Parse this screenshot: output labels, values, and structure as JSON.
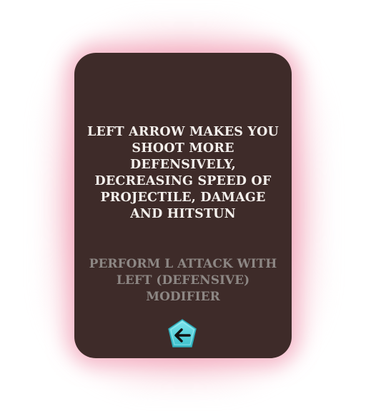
{
  "card": {
    "description": "Left arrow makes you shoot more defensively, decreasing speed of projectile, damage and hitstun",
    "instruction": "Perform L attack with left (defensive) modifier",
    "key_icon": "left-arrow-key-icon"
  },
  "colors": {
    "card_background": "#3e2b29",
    "glow": "#ec84a0",
    "description_text": "#f4f0ec",
    "instruction_text": "#8d8784",
    "key_fill": "#5ed9e3",
    "arrow": "#111111"
  }
}
